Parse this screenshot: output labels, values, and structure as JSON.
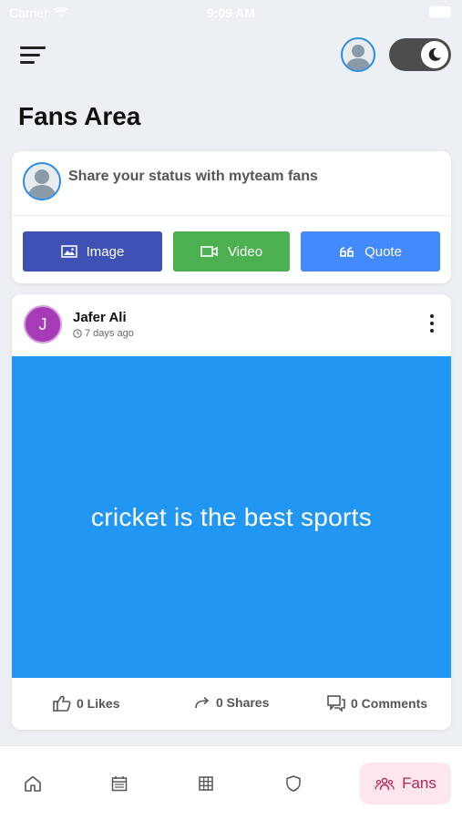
{
  "status_bar": {
    "carrier": "Carrier",
    "time": "9:09 AM"
  },
  "header": {
    "menu_icon": "hamburger-menu-icon",
    "theme_toggle": "dark-mode-toggle"
  },
  "page": {
    "title": "Fans Area"
  },
  "share": {
    "prompt": "Share your status with myteam fans",
    "buttons": [
      {
        "label": "Image",
        "icon": "image-icon",
        "color": "#3f51b5"
      },
      {
        "label": "Video",
        "icon": "video-icon",
        "color": "#4caf50"
      },
      {
        "label": "Quote",
        "icon": "quote-icon",
        "color": "#448aff"
      }
    ]
  },
  "post": {
    "avatar_letter": "J",
    "avatar_color": "#a53bb5",
    "author": "Jafer Ali",
    "time": "7 days ago",
    "content": "cricket is the best sports",
    "content_bg": "#2196f3",
    "likes": "0 Likes",
    "shares": "0 Shares",
    "comments": "0 Comments"
  },
  "bottom_nav": {
    "items": [
      "home-icon",
      "calendar-icon",
      "grid-icon",
      "shield-icon"
    ],
    "active_label": "Fans",
    "active_color": "#b3225a"
  }
}
